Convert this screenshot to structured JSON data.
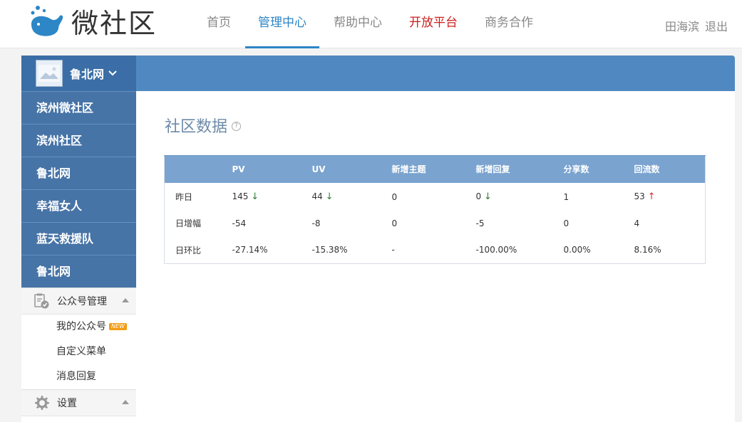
{
  "header": {
    "logo_text": "微社区",
    "nav": [
      {
        "label": "首页",
        "state": "normal"
      },
      {
        "label": "管理中心",
        "state": "active"
      },
      {
        "label": "帮助中心",
        "state": "normal"
      },
      {
        "label": "开放平台",
        "state": "highlight"
      },
      {
        "label": "商务合作",
        "state": "normal"
      }
    ],
    "user_name": "田海滨",
    "logout_label": "退出"
  },
  "sidebar": {
    "account_name": "鲁北网",
    "communities": [
      "滨州微社区",
      "滨州社区",
      "鲁北网",
      "幸福女人",
      "蓝天救援队",
      "鲁北网"
    ],
    "sections": [
      {
        "label": "公众号管理",
        "icon": "clipboard-check-icon",
        "items": [
          {
            "label": "我的公众号",
            "badge": "NEW"
          },
          {
            "label": "自定义菜单"
          },
          {
            "label": "消息回复"
          }
        ]
      },
      {
        "label": "设置",
        "icon": "gear-icon",
        "items": []
      }
    ]
  },
  "main": {
    "title": "社区数据",
    "help_symbol": "?",
    "table": {
      "headers": [
        "",
        "PV",
        "UV",
        "新增主题",
        "新增回复",
        "分享数",
        "回流数"
      ],
      "rows": [
        {
          "label": "昨日",
          "pv": "145",
          "uv": "44",
          "topics": "0",
          "replies": "0",
          "shares": "1",
          "backflow": "53"
        },
        {
          "label": "日增幅",
          "pv": "-54",
          "uv": "-8",
          "topics": "0",
          "replies": "-5",
          "shares": "0",
          "backflow": "4"
        },
        {
          "label": "日环比",
          "pv": "-27.14%",
          "uv": "-15.38%",
          "topics": "-",
          "replies": "-100.00%",
          "shares": "0.00%",
          "backflow": "8.16%"
        }
      ],
      "arrows": {
        "down": "↓",
        "up": "↑"
      }
    }
  },
  "colors": {
    "accent": "#2d86c6",
    "sidebar_blue": "#4774a7",
    "table_header": "#7aa3cf",
    "decrease": "#2e7d32",
    "increase": "#d32f2f"
  }
}
